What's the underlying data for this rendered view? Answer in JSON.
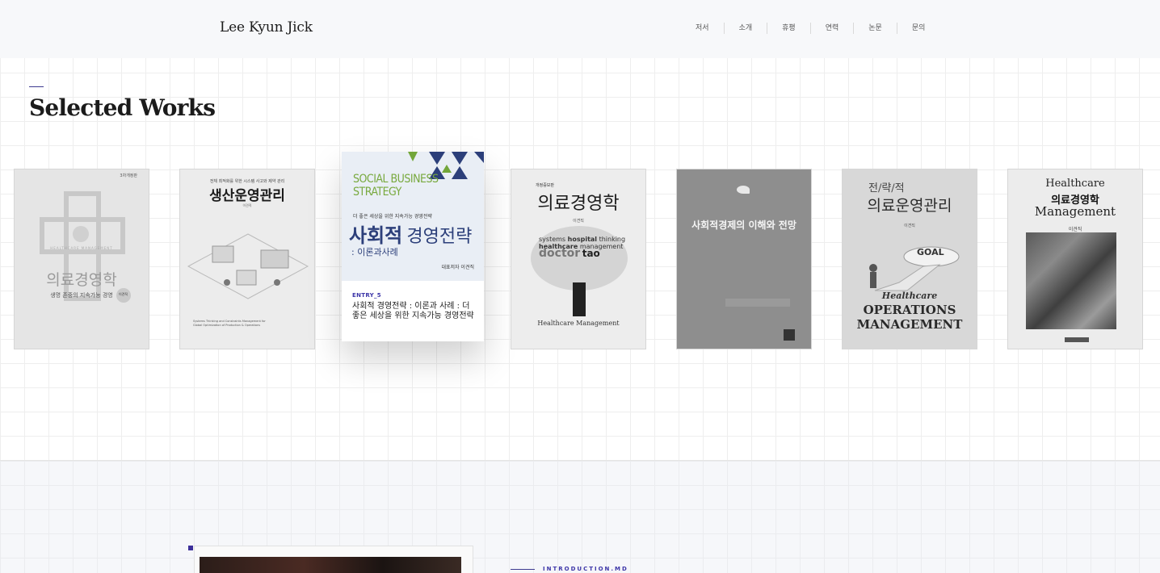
{
  "header": {
    "logo": "Lee Kyun Jick",
    "nav": [
      "저서",
      "소개",
      "휴평",
      "연력",
      "논문",
      "문의"
    ]
  },
  "works": {
    "title": "Selected Works",
    "books": [
      {
        "lines": [
          "3차개정판",
          "HEALTHCARE MANAGEMENT",
          "의료경영학",
          "생명 존중의 지속가능 경영",
          "이견직"
        ]
      },
      {
        "lines": [
          "전체 최적화를 위한 시스템 사고와 제약 관리",
          "생산운영관리",
          "이견직",
          "Systems Thinking and Constraints Management for Global Optimization of Production & Operations"
        ]
      },
      {
        "lines": [
          "개정증보판",
          "의료경영학",
          "이견직",
          "hospital",
          "systems",
          "thinking",
          "healthcare",
          "management",
          "doctor",
          "tao",
          "Healthcare Management"
        ]
      },
      {
        "lines": [
          "사회적경제의 이해와 전망"
        ]
      },
      {
        "lines": [
          "전/략/적",
          "의료운영관리",
          "이견직",
          "GOAL",
          "Healthcare",
          "OPERATIONS",
          "MANAGEMENT"
        ]
      },
      {
        "lines": [
          "Healthcare",
          "의료경영학",
          "Management",
          "이견직"
        ]
      }
    ],
    "featured": {
      "cover_en": "SOCIAL BUSINESS STRATEGY",
      "cover_sub": "더 좋은 세상을 위한 지속가능 경영전략",
      "cover_ko_1": "사회적",
      "cover_ko_2": "경영전략",
      "cover_ko_3": ": 이론과사례",
      "cover_author": "대표저자 이견직",
      "entry": "ENTRY_5",
      "title": "사회적 경영전략 : 이론과 사례 : 더 좋은 세상을 위한 지속가능 경영전략"
    }
  },
  "intro": {
    "label": "INTRODUCTION.MD"
  }
}
